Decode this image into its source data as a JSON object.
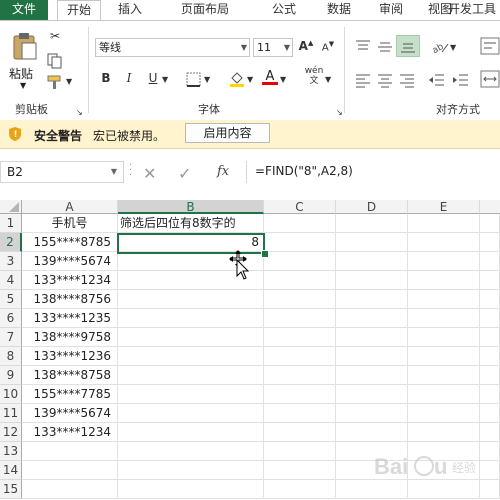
{
  "ribbon_tabs": [
    "文件",
    "开始",
    "插入",
    "页面布局",
    "公式",
    "数据",
    "审阅",
    "视图",
    "开发工具"
  ],
  "clipboard": {
    "paste_label": "粘贴",
    "group_label": "剪贴板"
  },
  "font": {
    "name": "等线",
    "size": "11",
    "group_label": "字体",
    "bold": "B",
    "italic": "I",
    "underline": "U",
    "wen": "wén",
    "grow": "A",
    "shrink": "A"
  },
  "alignment": {
    "group_label": "对齐方式"
  },
  "security": {
    "title": "安全警告",
    "message": "宏已被禁用。",
    "button": "启用内容"
  },
  "formula_bar": {
    "name_box": "B2",
    "fx": "fx",
    "formula": "=FIND(\"8\",A2,8)"
  },
  "columns": [
    "A",
    "B",
    "C",
    "D",
    "E"
  ],
  "rows": [
    "1",
    "2",
    "3",
    "4",
    "5",
    "6",
    "7",
    "8",
    "9",
    "10",
    "11",
    "12",
    "13",
    "14",
    "15"
  ],
  "sheet": {
    "a1": "手机号",
    "b1": "筛选后四位有8数字的",
    "b2": "8",
    "phones": [
      "155****8785",
      "139****5674",
      "133****1234",
      "138****8756",
      "133****1235",
      "138****9758",
      "133****1236",
      "138****8758",
      "155****7785",
      "139****5674",
      "133****1234"
    ]
  },
  "colors": {
    "file_tab": "#217346",
    "selection": "#217346",
    "security_bg": "#fff4ce"
  }
}
